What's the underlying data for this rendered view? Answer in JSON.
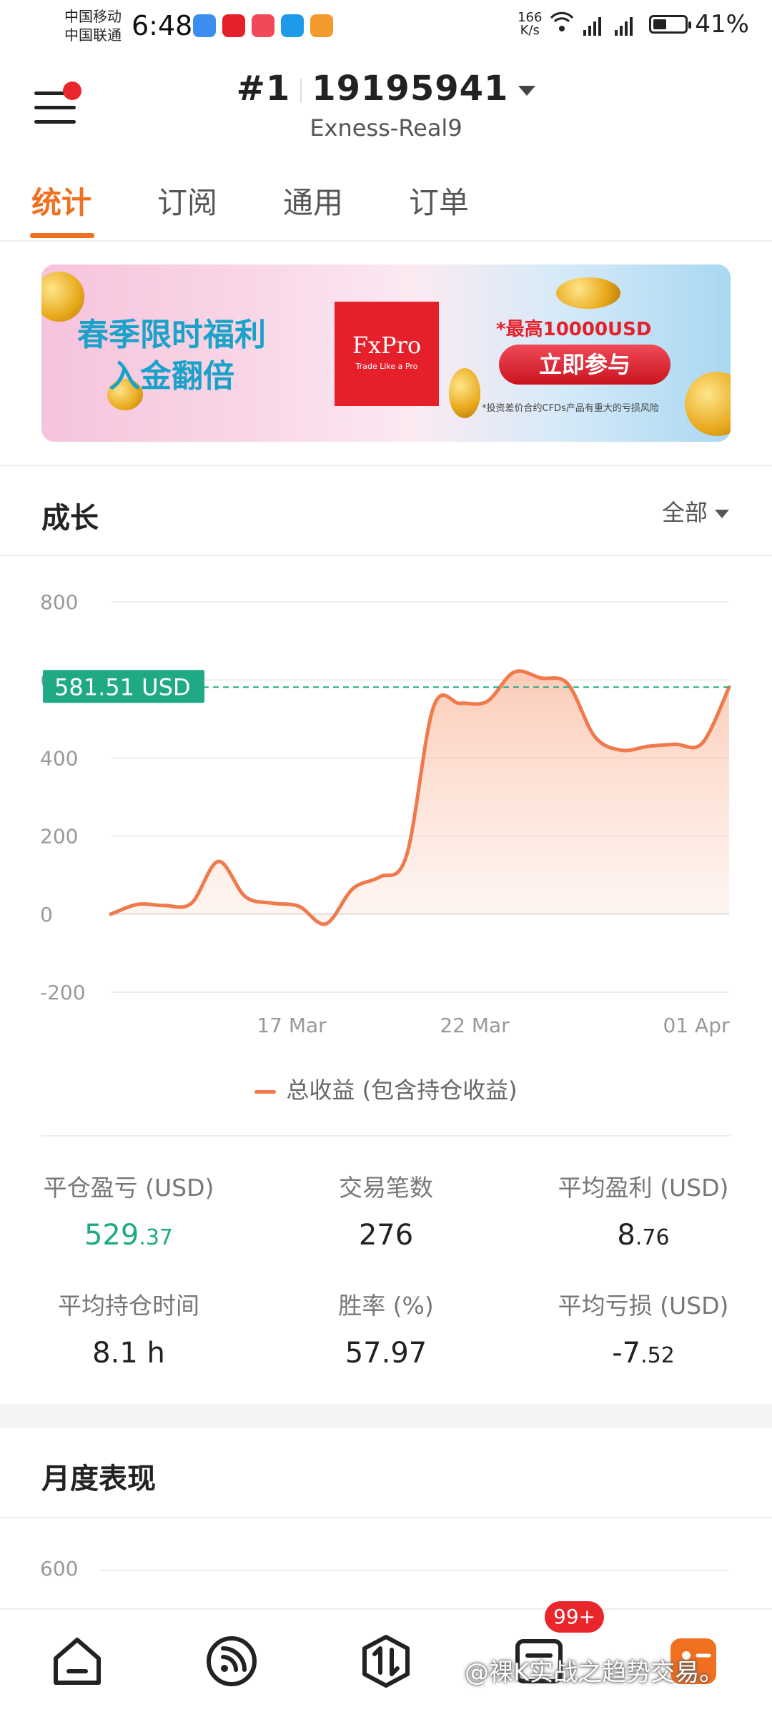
{
  "status_bar": {
    "carrier_1": "中国移动",
    "carrier_2": "中国联通",
    "time": "6:48",
    "net_speed_value": "166",
    "net_speed_unit": "K/s",
    "battery": "41%",
    "battery_level": 0.41
  },
  "header": {
    "account_rank": "#1",
    "account_number": "19195941",
    "server": "Exness-Real9"
  },
  "tabs": [
    {
      "label": "统计",
      "active": true
    },
    {
      "label": "订阅",
      "active": false
    },
    {
      "label": "通用",
      "active": false
    },
    {
      "label": "订单",
      "active": false
    }
  ],
  "banner": {
    "title_line1": "春季限时福利",
    "title_line2": "入金翻倍",
    "brand": "FxPro",
    "brand_tagline": "Trade Like a Pro",
    "promo_amount": "*最高10000USD",
    "cta": "立即参与",
    "disclaimer": "*投资差价合约CFDs产品有重大的亏损风险"
  },
  "growth": {
    "title": "成长",
    "range_label": "全部",
    "current_value_label": "581.51 USD",
    "legend": "总收益 (包含持仓收益)"
  },
  "chart_data": {
    "type": "area",
    "x_tick_labels": [
      "17 Mar",
      "22 Mar",
      "01 Apr"
    ],
    "y_tick_labels": [
      "800",
      "600",
      "400",
      "200",
      "0",
      "-200"
    ],
    "ylim": [
      -200,
      800
    ],
    "grid": true,
    "current_value": 581.51,
    "series": [
      {
        "name": "总收益 (包含持仓收益)",
        "color": "#ef7a4c",
        "values": [
          0,
          25,
          22,
          28,
          135,
          45,
          28,
          20,
          -25,
          65,
          95,
          150,
          530,
          540,
          545,
          620,
          605,
          590,
          455,
          420,
          430,
          435,
          438,
          581.51
        ]
      }
    ]
  },
  "stats": [
    {
      "label": "平仓盈亏 (USD)",
      "int": "529",
      "dec": ".37",
      "green": true
    },
    {
      "label": "交易笔数",
      "int": "276",
      "dec": "",
      "green": false
    },
    {
      "label": "平均盈利 (USD)",
      "int": "8",
      "dec": ".76",
      "green": false
    },
    {
      "label": "平均持仓时间",
      "int": "8.1 h",
      "dec": "",
      "green": false
    },
    {
      "label": "胜率 (%)",
      "int": "57.97",
      "dec": "",
      "green": false
    },
    {
      "label": "平均亏损 (USD)",
      "int": "-7",
      "dec": ".52",
      "green": false
    }
  ],
  "monthly": {
    "title": "月度表现",
    "first_tick": "600"
  },
  "bottom_nav": {
    "badge": "99+",
    "watermark": "@裸K实战之趋势交易。"
  },
  "colors": {
    "accent": "#f07020",
    "line": "#ef7a4c",
    "current_tag": "#1fa985",
    "profit_green": "#1fa985"
  }
}
